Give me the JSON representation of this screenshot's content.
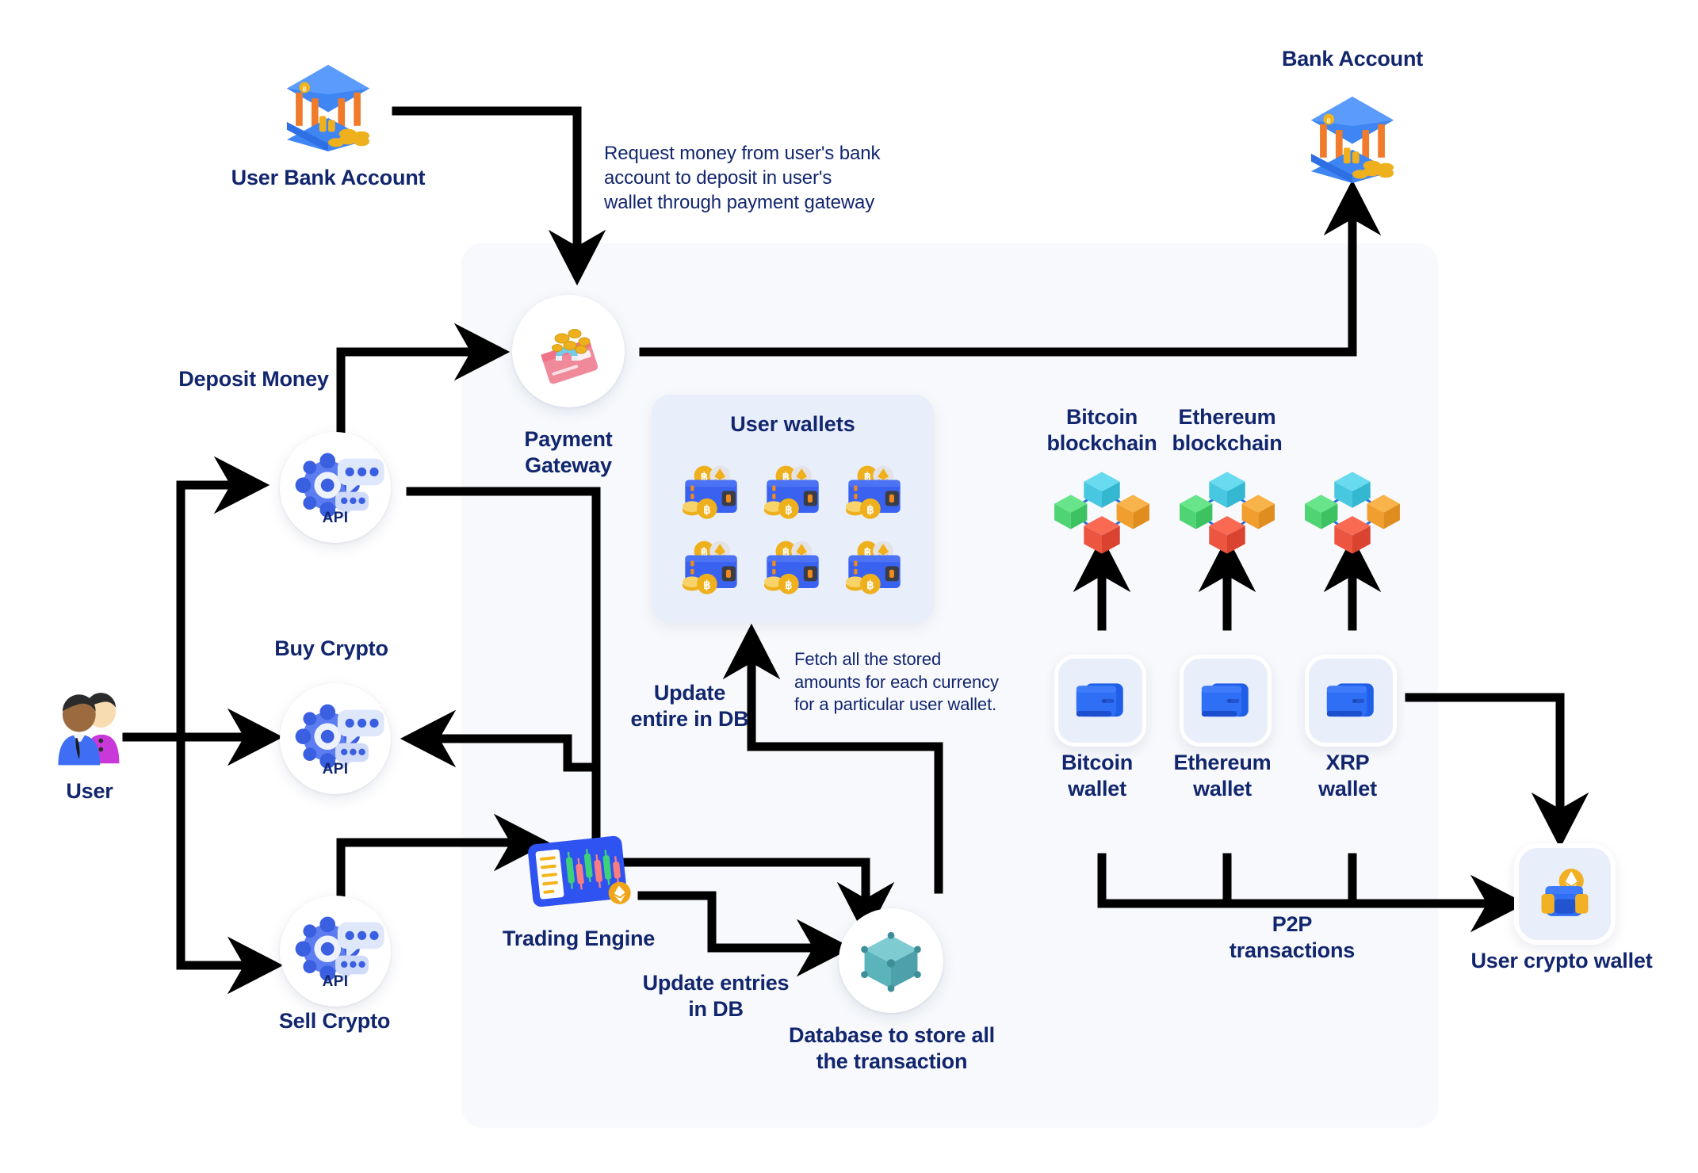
{
  "diagram": {
    "title": "Crypto exchange architecture flow",
    "colors": {
      "label_blue": "#12266e",
      "panel_bg": "#f7f9fc",
      "card_bg": "#e9eefb",
      "arrow_black": "#000000",
      "accent_blue": "#2f6fe4"
    },
    "nodes": {
      "user_bank_account": "User Bank Account",
      "bank_account": "Bank Account",
      "payment_gateway": "Payment\nGateway",
      "user": "User",
      "api_deposit": "API",
      "api_buy": "API",
      "api_sell": "API",
      "trading_engine": "Trading Engine",
      "database": "Database to store all\nthe transaction",
      "user_wallets_title": "User wallets",
      "user_crypto_wallet": "User crypto wallet"
    },
    "edge_labels": {
      "deposit_money": "Deposit Money",
      "buy_crypto": "Buy Crypto",
      "sell_crypto": "Sell Crypto",
      "update_entire_in_db": "Update\nentire in DB",
      "update_entries_in_db": "Update entries\nin DB",
      "p2p_transactions": "P2P\ntransactions"
    },
    "annotations": {
      "request_money": "Request money from user's bank\naccount to deposit in user's\nwallet through payment gateway",
      "fetch_amounts": "Fetch all the stored\namounts for each currency\nfor a particular user wallet."
    },
    "blockchains": [
      {
        "label": "Bitcoin\nblockchain"
      },
      {
        "label": "Ethereum\nblockchain"
      },
      {
        "label": ""
      }
    ],
    "wallets": [
      {
        "label": "Bitcoin\nwallet"
      },
      {
        "label": "Ethereum\nwallet"
      },
      {
        "label": "XRP\nwallet"
      }
    ],
    "user_wallets_count": 6
  }
}
